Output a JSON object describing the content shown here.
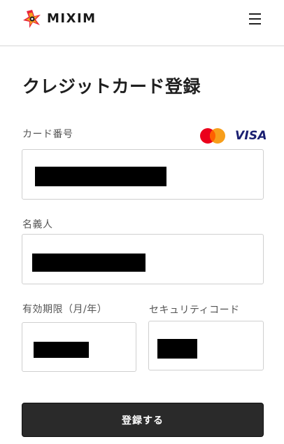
{
  "header": {
    "logo_text": "MIXIM",
    "logo_icon": "mixim-star-logo-icon",
    "menu_icon": "hamburger-menu-icon"
  },
  "page": {
    "title": "クレジットカード登録"
  },
  "form": {
    "card_number": {
      "label": "カード番号",
      "value": ""
    },
    "card_holder": {
      "label": "名義人",
      "value": ""
    },
    "expiry": {
      "label": "有効期限（月/年）",
      "value": ""
    },
    "security_code": {
      "label": "セキュリティコード",
      "value": ""
    },
    "brands": [
      "mastercard",
      "VISA"
    ],
    "visa_label": "VISA"
  },
  "submit": {
    "label": "登録する"
  },
  "colors": {
    "primary_button": "#2a2a2a",
    "mastercard_red": "#eb001b",
    "mastercard_orange": "#f79e1b",
    "visa_blue": "#1a1f71",
    "field_border": "#cfcfcf"
  }
}
